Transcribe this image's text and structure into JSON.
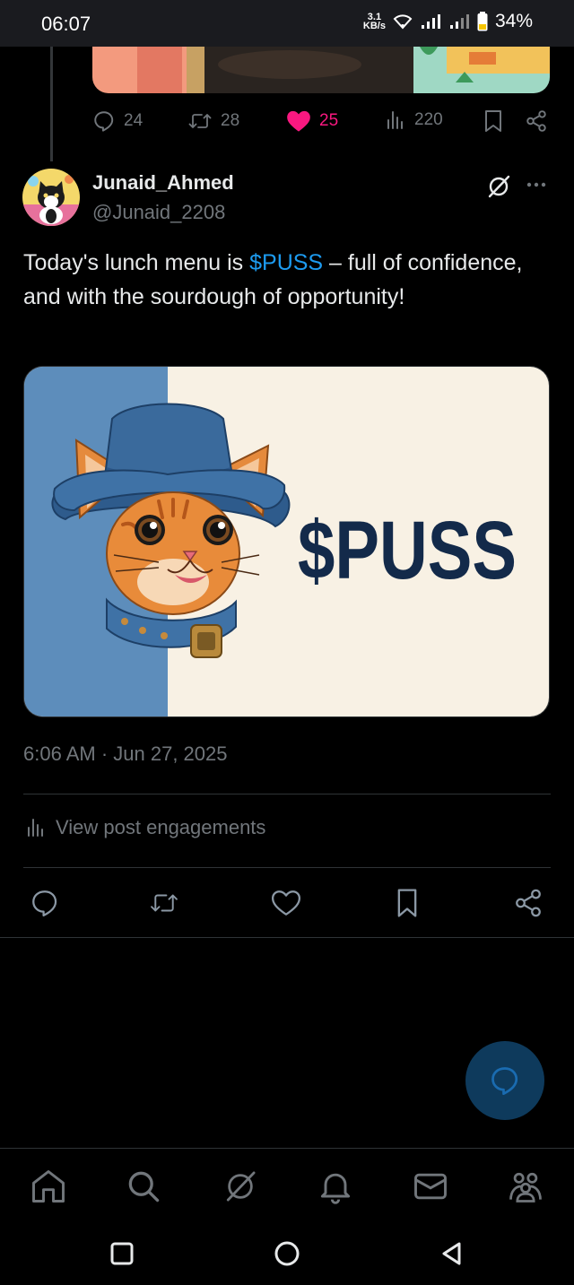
{
  "status_bar": {
    "time": "06:07",
    "network_speed_value": "3.1",
    "network_speed_unit": "KB/s",
    "battery": "34%"
  },
  "previous_post": {
    "replies": "24",
    "reposts": "28",
    "likes": "25",
    "views": "220",
    "liked": true
  },
  "post": {
    "author_name": "Junaid_Ahmed",
    "author_handle": "@Junaid_2208",
    "text_before": "Today's lunch menu is ",
    "cashtag": "$PUSS",
    "text_after": " – full of confidence, and with the sourdough of opportunity!",
    "media_text": "$PUSS",
    "timestamp": "6:06 AM · Jun 27, 2025",
    "engagements_label": "View post engagements"
  },
  "colors": {
    "accent": "#1d9bf0",
    "like": "#f91880",
    "muted": "#71767b",
    "background": "#000000"
  },
  "icons": {
    "reply": "reply-icon",
    "repost": "repost-icon",
    "like": "heart-icon",
    "bookmark": "bookmark-icon",
    "share": "share-icon",
    "views": "views-icon",
    "grok": "grok-icon",
    "more": "more-icon"
  },
  "bottom_nav": [
    "home-icon",
    "search-icon",
    "grok-icon",
    "notifications-icon",
    "messages-icon",
    "communities-icon"
  ]
}
